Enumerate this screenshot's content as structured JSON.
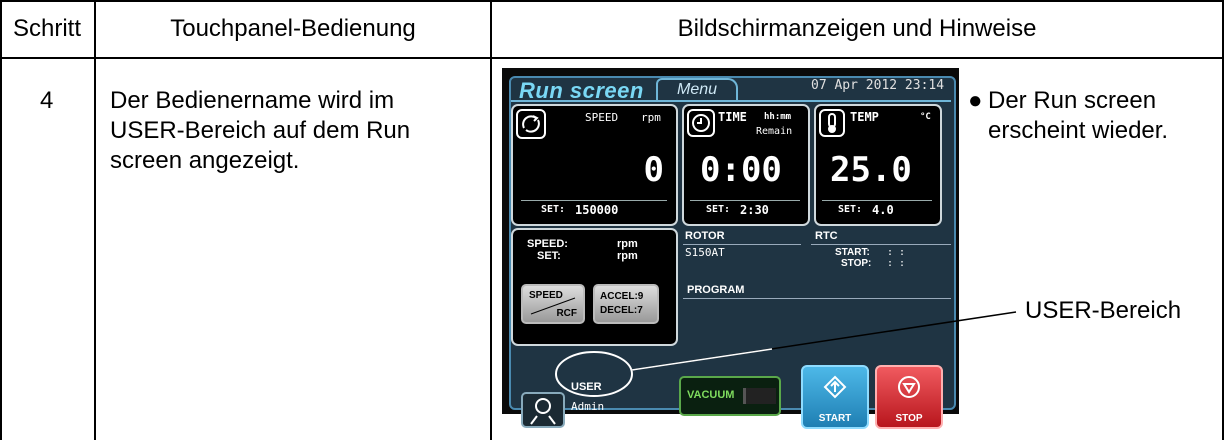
{
  "table": {
    "headers": [
      "Schritt",
      "Touchpanel-Bedienung",
      "Bildschirmanzeigen und Hinweise"
    ],
    "step": "4",
    "operation_lines": [
      "Der Bedienername wird im",
      "USER-Bereich auf dem Run",
      "screen angezeigt."
    ],
    "note_lines": [
      "Der Run screen",
      "erscheint wieder."
    ],
    "callout": "USER-Bereich"
  },
  "screen": {
    "title": "Run screen",
    "menu_tab": "Menu",
    "datetime": "07 Apr 2012 23:14",
    "speed": {
      "label": "SPEED",
      "unit": "rpm",
      "value": "0",
      "set_label": "SET:",
      "set_value": "150000"
    },
    "time": {
      "label": "TIME",
      "unit": "hh:mm",
      "sub": "Remain",
      "value": "0:00",
      "set_label": "SET:",
      "set_value": "2:30"
    },
    "temp": {
      "label": "TEMP",
      "unit": "°C",
      "value": "25.0",
      "set_label": "SET:",
      "set_value": "4.0"
    },
    "speed_info": {
      "speed_label": "SPEED:",
      "speed_unit": "rpm",
      "set_label": "SET:",
      "set_unit": "rpm"
    },
    "speed_rcf_btn": {
      "top": "SPEED",
      "bottom": "RCF"
    },
    "accel_btn": {
      "accel": "ACCEL:9",
      "decel": "DECEL:7"
    },
    "rotor": {
      "label": "ROTOR",
      "value": "S150AT"
    },
    "rtc": {
      "label": "RTC",
      "start": "START:",
      "stop": "STOP:",
      "start_val": ":   :",
      "stop_val": ":   :"
    },
    "program": {
      "label": "PROGRAM"
    },
    "user": {
      "label": "USER",
      "name": "Admin"
    },
    "vacuum": "VACUUM",
    "start": "START",
    "stop": "STOP"
  },
  "colors": {
    "accent": "#7ad8f5",
    "start": "#3fa9d8",
    "stop": "#e0333a",
    "vacuum": "#5aa84a"
  }
}
